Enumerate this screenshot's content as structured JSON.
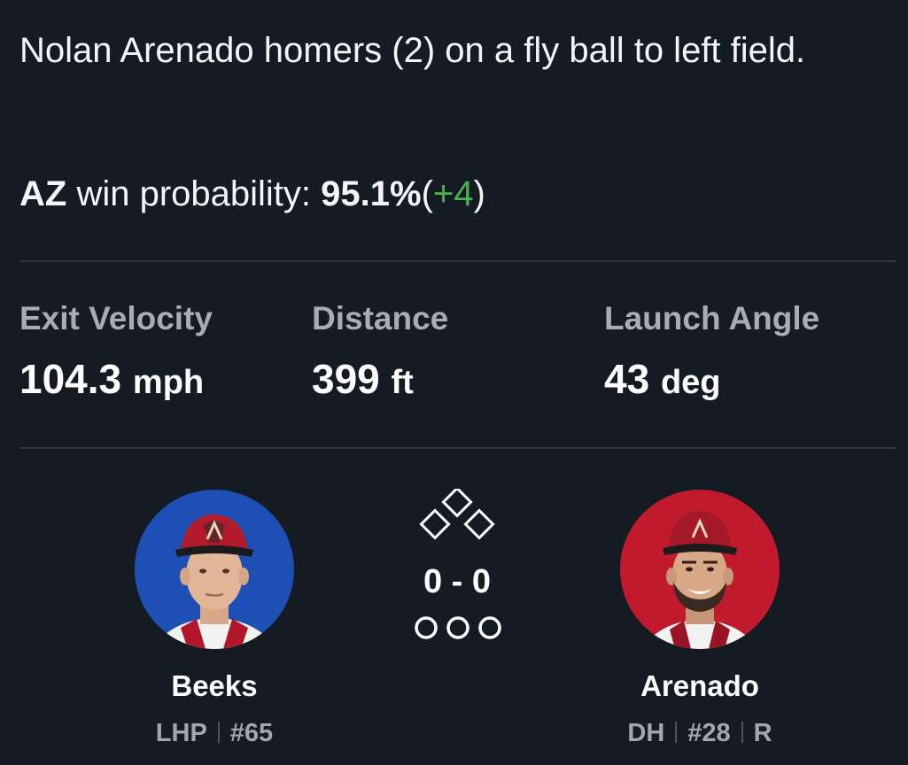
{
  "play": {
    "description": "Nolan Arenado homers (2) on a fly ball to left field."
  },
  "win_probability": {
    "team": "AZ",
    "label": "win probability:",
    "value": "95.1%",
    "open_paren": "(",
    "change": "+4",
    "close_paren": ")",
    "change_color": "#4caf50"
  },
  "statcast": [
    {
      "label": "Exit Velocity",
      "value": "104.3",
      "unit": "mph"
    },
    {
      "label": "Distance",
      "value": "399",
      "unit": "ft"
    },
    {
      "label": "Launch Angle",
      "value": "43",
      "unit": "deg"
    }
  ],
  "pitcher": {
    "name": "Beeks",
    "position": "LHP",
    "number": "#65",
    "avatar_bg": "#1e4fb4"
  },
  "batter": {
    "name": "Arenado",
    "position": "DH",
    "number": "#28",
    "bats": "R",
    "avatar_bg": "#c01a2c"
  },
  "situation": {
    "count": "0 - 0",
    "bases_occupied": [
      false,
      false,
      false
    ],
    "outs": 0
  }
}
